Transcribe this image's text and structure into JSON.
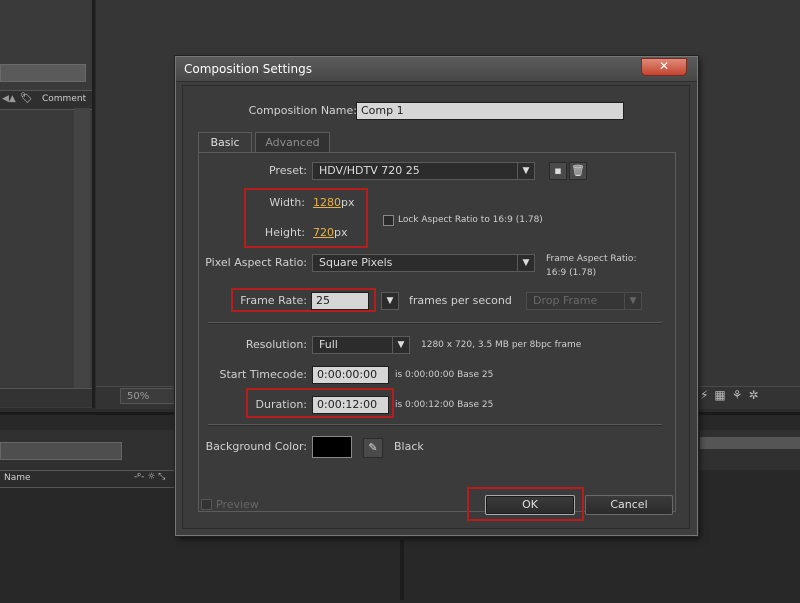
{
  "background": {
    "project_column_comment": "Comment",
    "comp_zoom": "50%",
    "timeline_column_name": "Name",
    "timeline_switches": "-ᵖ- ☼ ⤡"
  },
  "dialog": {
    "title": "Composition Settings",
    "close_glyph": "✕",
    "composition_name_label": "Composition Name:",
    "composition_name_value": "Comp 1",
    "tabs": [
      {
        "label": "Basic",
        "active": true
      },
      {
        "label": "Advanced",
        "active": false
      }
    ],
    "preset_label": "Preset:",
    "preset_value": "HDV/HDTV 720 25",
    "width_label": "Width:",
    "width_value": "1280",
    "width_unit": "px",
    "height_label": "Height:",
    "height_value": "720",
    "height_unit": "px",
    "lock_aspect_label": "Lock Aspect Ratio to 16:9 (1.78)",
    "pixel_aspect_label": "Pixel Aspect Ratio:",
    "pixel_aspect_value": "Square Pixels",
    "frame_aspect_label": "Frame Aspect Ratio:",
    "frame_aspect_value": "16:9 (1.78)",
    "frame_rate_label": "Frame Rate:",
    "frame_rate_value": "25",
    "frame_rate_unit": "frames per second",
    "drop_frame_value": "Drop Frame",
    "resolution_label": "Resolution:",
    "resolution_value": "Full",
    "resolution_info": "1280 x 720, 3.5 MB per 8bpc frame",
    "start_timecode_label": "Start Timecode:",
    "start_timecode_value": "0:00:00:00",
    "start_timecode_info": "is 0:00:00:00  Base 25",
    "duration_label": "Duration:",
    "duration_value": "0:00:12:00",
    "duration_info": "is 0:00:12:00  Base 25",
    "background_color_label": "Background Color:",
    "background_color_hex": "#000000",
    "background_color_name": "Black",
    "preview_label": "Preview",
    "ok_label": "OK",
    "cancel_label": "Cancel"
  },
  "colors": {
    "highlight_box": "#b81d1d",
    "value_accent": "#e5b24a",
    "dialog_bg": "#3b3b3b"
  }
}
